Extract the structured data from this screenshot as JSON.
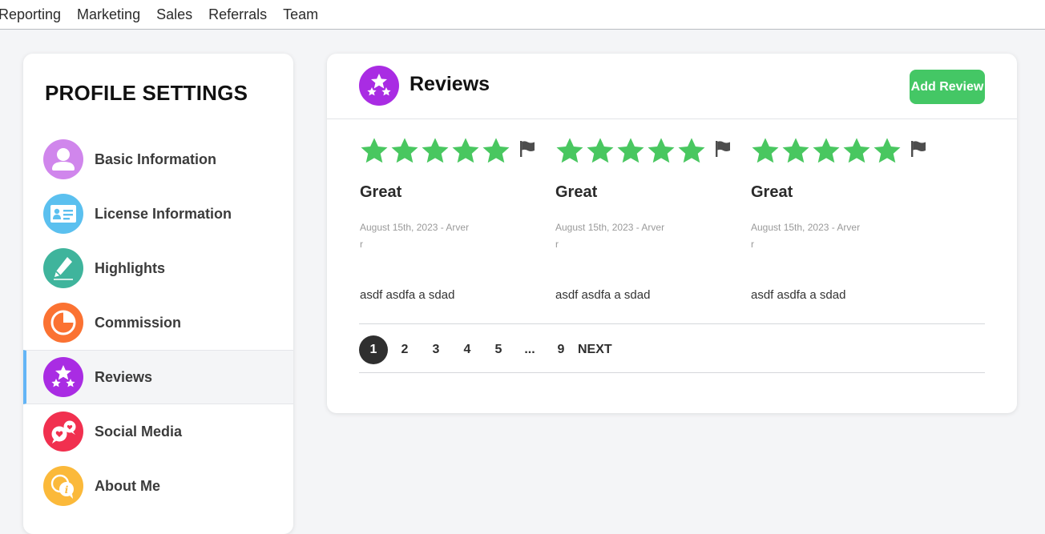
{
  "topnav": {
    "items": [
      "Reporting",
      "Marketing",
      "Sales",
      "Referrals",
      "Team"
    ]
  },
  "sidebar": {
    "title": "PROFILE SETTINGS",
    "items": [
      {
        "label": "Basic Information",
        "icon": "user-icon",
        "color": "#d086ec"
      },
      {
        "label": "License Information",
        "icon": "id-card-icon",
        "color": "#5bc0ef"
      },
      {
        "label": "Highlights",
        "icon": "pencil-icon",
        "color": "#3fb49c"
      },
      {
        "label": "Commission",
        "icon": "pie-chart-icon",
        "color": "#fb7232"
      },
      {
        "label": "Reviews",
        "icon": "stars-icon",
        "color": "#a92ce3"
      },
      {
        "label": "Social Media",
        "icon": "chat-hearts-icon",
        "color": "#f1304f"
      },
      {
        "label": "About Me",
        "icon": "info-bubble-icon",
        "color": "#fbb93a"
      }
    ],
    "active_index": 4,
    "active_color": "#64b5f6"
  },
  "main": {
    "title": "Reviews",
    "header_icon": "stars-icon",
    "header_icon_color": "#a92ce3",
    "add_button_label": "Add Review",
    "add_button_color": "#44c765",
    "star_color": "#49c760",
    "flag_color": "#4d4d4d",
    "reviews": [
      {
        "rating": 5,
        "title": "Great",
        "meta": "August 15th, 2023 - Arverr",
        "body": "asdf asdfa a sdad"
      },
      {
        "rating": 5,
        "title": "Great",
        "meta": "August 15th, 2023 - Arverr",
        "body": "asdf asdfa a sdad"
      },
      {
        "rating": 5,
        "title": "Great",
        "meta": "August 15th, 2023 - Arverr",
        "body": "asdf asdfa a sdad"
      }
    ],
    "pagination": {
      "current": "1",
      "pages": [
        "1",
        "2",
        "3",
        "4",
        "5",
        "...",
        "9"
      ],
      "next_label": "NEXT"
    }
  }
}
